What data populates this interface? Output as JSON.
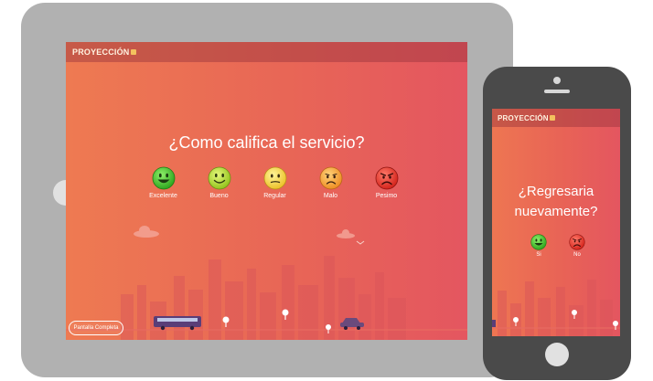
{
  "brand": {
    "logo_text": "PROYECCIÓN"
  },
  "tablet": {
    "question": "¿Como califica el servicio?",
    "options": [
      {
        "label": "Excelente",
        "icon": "very-happy-face-icon",
        "color": "#3fbf2f"
      },
      {
        "label": "Bueno",
        "icon": "happy-face-icon",
        "color": "#a8d92c"
      },
      {
        "label": "Regular",
        "icon": "neutral-face-icon",
        "color": "#f5d13a"
      },
      {
        "label": "Malo",
        "icon": "sad-face-icon",
        "color": "#f39a2e"
      },
      {
        "label": "Pesimo",
        "icon": "angry-face-icon",
        "color": "#e8322a"
      }
    ],
    "fullscreen_label": "Pantalla Completa"
  },
  "phone": {
    "question_line1": "¿Regresaria",
    "question_line2": "nuevamente?",
    "options": [
      {
        "label": "Si",
        "icon": "happy-face-icon",
        "color": "#3fbf2f"
      },
      {
        "label": "No",
        "icon": "angry-face-icon",
        "color": "#e8322a"
      }
    ]
  }
}
